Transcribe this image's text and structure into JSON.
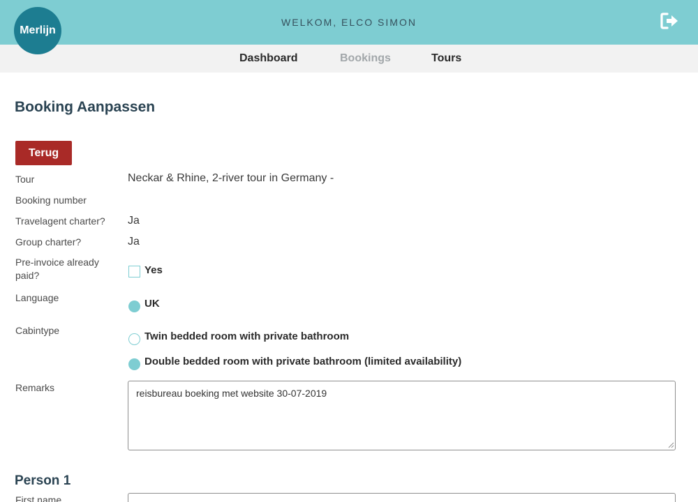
{
  "header": {
    "logo_text": "Merlijn",
    "welcome": "WELKOM, ELCO SIMON",
    "logout_icon": "logout-icon",
    "colors": {
      "bar": "#7ecdd2",
      "logo": "#1d7d91",
      "accent_button": "#a92a27"
    }
  },
  "nav": {
    "items": [
      {
        "label": "Dashboard",
        "active": false
      },
      {
        "label": "Bookings",
        "active": true
      },
      {
        "label": "Tours",
        "active": false
      }
    ]
  },
  "page": {
    "title": "Booking Aanpassen",
    "back_button": "Terug"
  },
  "form": {
    "tour": {
      "label": "Tour",
      "value": "Neckar & Rhine, 2-river tour in Germany -"
    },
    "booking_number": {
      "label": "Booking number",
      "value": ""
    },
    "travelagent_charter": {
      "label": "Travelagent charter?",
      "value": "Ja"
    },
    "group_charter": {
      "label": "Group charter?",
      "value": "Ja"
    },
    "pre_invoice": {
      "label": "Pre-invoice already paid?",
      "option": "Yes",
      "checked": false
    },
    "language": {
      "label": "Language",
      "option": "UK",
      "selected": true
    },
    "cabintype": {
      "label": "Cabintype",
      "options": [
        {
          "label": "Twin bedded room with private bathroom",
          "selected": false
        },
        {
          "label": "Double bedded room with private bathroom (limited availability)",
          "selected": true
        }
      ]
    },
    "remarks": {
      "label": "Remarks",
      "value": "reisbureau boeking met website 30-07-2019"
    }
  },
  "person": {
    "title": "Person 1",
    "first_name_label": "First name"
  }
}
